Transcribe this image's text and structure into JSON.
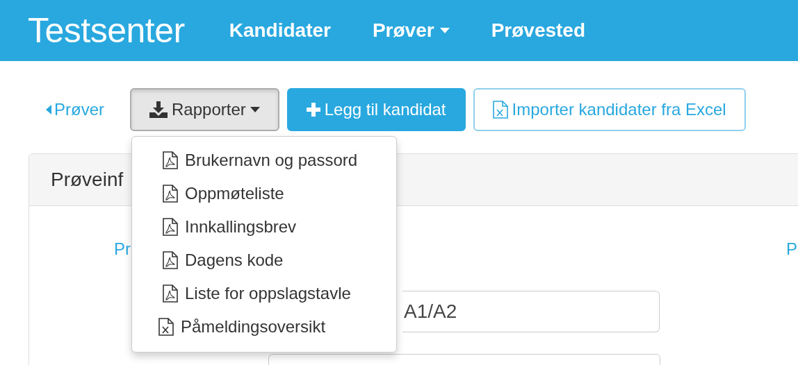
{
  "brand": "Testsenter",
  "nav": [
    {
      "label": "Kandidater",
      "kind": "link"
    },
    {
      "label": "Prøver",
      "kind": "dropdown"
    },
    {
      "label": "Prøvested",
      "kind": "link"
    }
  ],
  "toolbar": {
    "back_link": "Prøver",
    "reports_button": {
      "label": "Rapporter",
      "expanded": true
    },
    "add_button": "Legg til kandidat",
    "import_button": "Importer kandidater fra Excel"
  },
  "reports_menu": [
    {
      "label": "Brukernavn og passord",
      "kind": "pdf"
    },
    {
      "label": "Oppmøteliste",
      "kind": "pdf"
    },
    {
      "label": "Innkallingsbrev",
      "kind": "pdf"
    },
    {
      "label": "Dagens kode",
      "kind": "pdf"
    },
    {
      "label": "Liste for oppslagstavle",
      "kind": "pdf"
    },
    {
      "label": "Påmeldingsoversikt",
      "kind": "excel"
    }
  ],
  "panel": {
    "title": "Prøveinf",
    "left_label": "Pr",
    "right_label": "P",
    "field_value": "A1/A2"
  }
}
